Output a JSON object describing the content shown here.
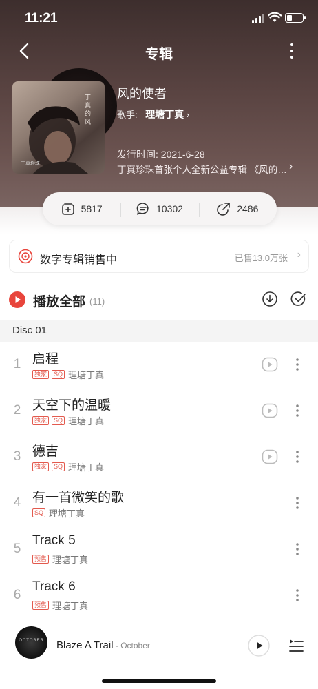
{
  "status_bar": {
    "time": "11:21",
    "battery_level": 0.35
  },
  "header": {
    "title": "专辑"
  },
  "album": {
    "title": "风的使者",
    "singer_label": "歌手:",
    "singer_name": "理塘丁真",
    "release_date": "发行时间: 2021-6-28",
    "description": "丁真珍珠首张个人全新公益专辑 《风的…",
    "cover_text": "丁真的风",
    "cover_small_text": "丁真珍珠"
  },
  "stats": {
    "collect": "5817",
    "comments": "10302",
    "shares": "2486"
  },
  "sale": {
    "label": "数字专辑销售中",
    "sold": "已售13.0万张"
  },
  "play_all": {
    "label": "播放全部",
    "count": "(11)"
  },
  "disc": {
    "label": "Disc 01"
  },
  "tracks": [
    {
      "num": "1",
      "title": "启程",
      "tags": [
        "独家",
        "SQ"
      ],
      "artist": "理塘丁真",
      "mv": true
    },
    {
      "num": "2",
      "title": "天空下的温暖",
      "tags": [
        "独家",
        "SQ"
      ],
      "artist": "理塘丁真",
      "mv": true
    },
    {
      "num": "3",
      "title": "德吉",
      "tags": [
        "独家",
        "SQ"
      ],
      "artist": "理塘丁真",
      "mv": true
    },
    {
      "num": "4",
      "title": "有一首微笑的歌",
      "tags": [
        "SQ"
      ],
      "artist": "理塘丁真",
      "mv": false
    },
    {
      "num": "5",
      "title": "Track 5",
      "tags": [
        "预售"
      ],
      "artist": "理塘丁真",
      "mv": false
    },
    {
      "num": "6",
      "title": "Track 6",
      "tags": [
        "预售"
      ],
      "artist": "理塘丁真",
      "mv": false
    }
  ],
  "mini_player": {
    "title": "Blaze A Trail",
    "artist": " - October",
    "cover_text": "OCTOBER"
  },
  "colors": {
    "accent": "#e8453c",
    "tag": "#e35a4e"
  }
}
